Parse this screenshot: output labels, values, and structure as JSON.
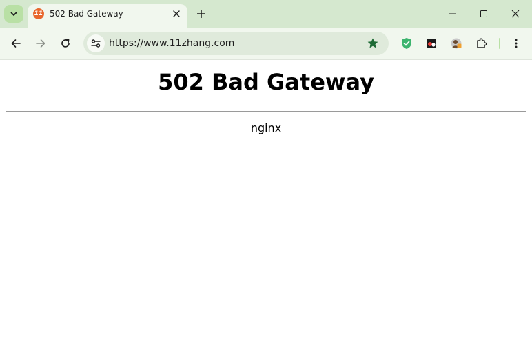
{
  "browser": {
    "tab": {
      "title": "502 Bad Gateway",
      "favicon_text": "11",
      "favicon_color": "#e8662c"
    },
    "omnibox": {
      "url": "https://www.11zhang.com"
    },
    "icons": {
      "tab_search": "chevron-down-icon",
      "tab_close": "close-icon",
      "new_tab": "plus-icon",
      "minimize": "minimize-icon",
      "maximize": "maximize-icon",
      "window_close": "close-icon",
      "back": "arrow-left-icon",
      "forward": "arrow-right-icon",
      "reload": "reload-icon",
      "site_info": "tune-icon",
      "bookmark": "star-icon",
      "extensions": [
        "shield-check-icon",
        "record-icon",
        "avatar-extension-icon",
        "puzzle-icon"
      ],
      "menu": "kebab-menu-icon"
    },
    "colors": {
      "frame": "#d5e8cf",
      "toolbar": "#f1f7ee",
      "omnibox": "#dfeadb",
      "accent": "#b9e0a5",
      "bookmark_star": "#1e6b35"
    }
  },
  "page": {
    "heading": "502 Bad Gateway",
    "server": "nginx"
  }
}
